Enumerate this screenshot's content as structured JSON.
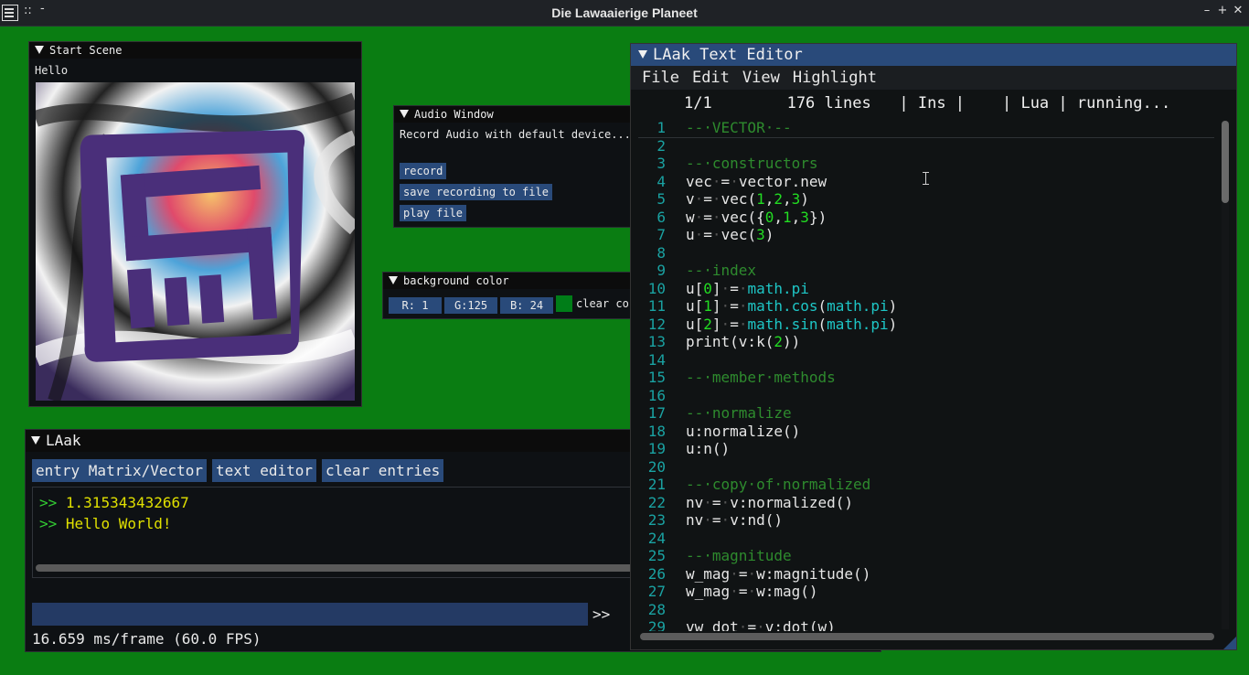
{
  "window": {
    "title": "Die Lawaaierige Planeet",
    "grip": "::",
    "min_hint": "-",
    "buttons": {
      "minimize": "–",
      "maximize": "+",
      "close": "✕"
    }
  },
  "start_scene": {
    "title": "Start Scene",
    "hello": "Hello"
  },
  "audio": {
    "title": "Audio Window",
    "description": "Record Audio with default device...",
    "record": "record",
    "save": "save recording to file",
    "play": "play file"
  },
  "bgcolor": {
    "title": "background color",
    "r": "R:  1",
    "g": "G:125",
    "b": "B: 24",
    "swatch_color": "#007d18",
    "clear": "clear co"
  },
  "console": {
    "title": "LAak",
    "buttons": [
      "entry Matrix/Vector",
      "text editor",
      "clear entries"
    ],
    "entries": [
      {
        "prompt": ">>",
        "value": "1.315343432667"
      },
      {
        "prompt": ">>",
        "value": "Hello World!"
      }
    ],
    "run": ">>",
    "fps": "16.659 ms/frame (60.0 FPS)"
  },
  "editor": {
    "title": "LAak Text Editor",
    "menu": [
      "File",
      "Edit",
      "View",
      "Highlight"
    ],
    "status": "1/1        176 lines   | Ins |    | Lua | running...",
    "lines": [
      {
        "n": "1",
        "code": "<span class='cm'>--·VECTOR·--</span>"
      },
      {
        "n": "2",
        "code": ""
      },
      {
        "n": "3",
        "code": "<span class='cm'>--·constructors</span>"
      },
      {
        "n": "4",
        "code": "vec<span class='dot'>·</span>=<span class='dot'>·</span>vector.new"
      },
      {
        "n": "5",
        "code": "v<span class='dot'>·</span>=<span class='dot'>·</span>vec(<span class='num'>1</span>,<span class='num'>2</span>,<span class='num'>3</span>)"
      },
      {
        "n": "6",
        "code": "w<span class='dot'>·</span>=<span class='dot'>·</span>vec({<span class='num'>0</span>,<span class='num'>1</span>,<span class='num'>3</span>})"
      },
      {
        "n": "7",
        "code": "u<span class='dot'>·</span>=<span class='dot'>·</span>vec(<span class='num'>3</span>)"
      },
      {
        "n": "8",
        "code": ""
      },
      {
        "n": "9",
        "code": "<span class='cm'>--·index</span>"
      },
      {
        "n": "10",
        "code": "u[<span class='num'>0</span>]<span class='dot'>·</span>=<span class='dot'>·</span><span class='fn'>math.pi</span>"
      },
      {
        "n": "11",
        "code": "u[<span class='num'>1</span>]<span class='dot'>·</span>=<span class='dot'>·</span><span class='fn'>math.cos</span>(<span class='fn'>math.pi</span>)"
      },
      {
        "n": "12",
        "code": "u[<span class='num'>2</span>]<span class='dot'>·</span>=<span class='dot'>·</span><span class='fn'>math.sin</span>(<span class='fn'>math.pi</span>)"
      },
      {
        "n": "13",
        "code": "print(v:k(<span class='num'>2</span>))"
      },
      {
        "n": "14",
        "code": ""
      },
      {
        "n": "15",
        "code": "<span class='cm'>--·member·methods</span>"
      },
      {
        "n": "16",
        "code": ""
      },
      {
        "n": "17",
        "code": "<span class='cm'>--·normalize</span>"
      },
      {
        "n": "18",
        "code": "u:normalize()"
      },
      {
        "n": "19",
        "code": "u:n()"
      },
      {
        "n": "20",
        "code": ""
      },
      {
        "n": "21",
        "code": "<span class='cm'>--·copy·of·normalized</span>"
      },
      {
        "n": "22",
        "code": "nv<span class='dot'>·</span>=<span class='dot'>·</span>v:normalized()"
      },
      {
        "n": "23",
        "code": "nv<span class='dot'>·</span>=<span class='dot'>·</span>v:nd()"
      },
      {
        "n": "24",
        "code": ""
      },
      {
        "n": "25",
        "code": "<span class='cm'>--·magnitude</span>"
      },
      {
        "n": "26",
        "code": "w_mag<span class='dot'>·</span>=<span class='dot'>·</span>w:magnitude()"
      },
      {
        "n": "27",
        "code": "w_mag<span class='dot'>·</span>=<span class='dot'>·</span>w:mag()"
      },
      {
        "n": "28",
        "code": ""
      },
      {
        "n": "29",
        "code": "vw_dot<span class='dot'>·</span>=<span class='dot'>·</span>v:dot(w)"
      }
    ]
  }
}
